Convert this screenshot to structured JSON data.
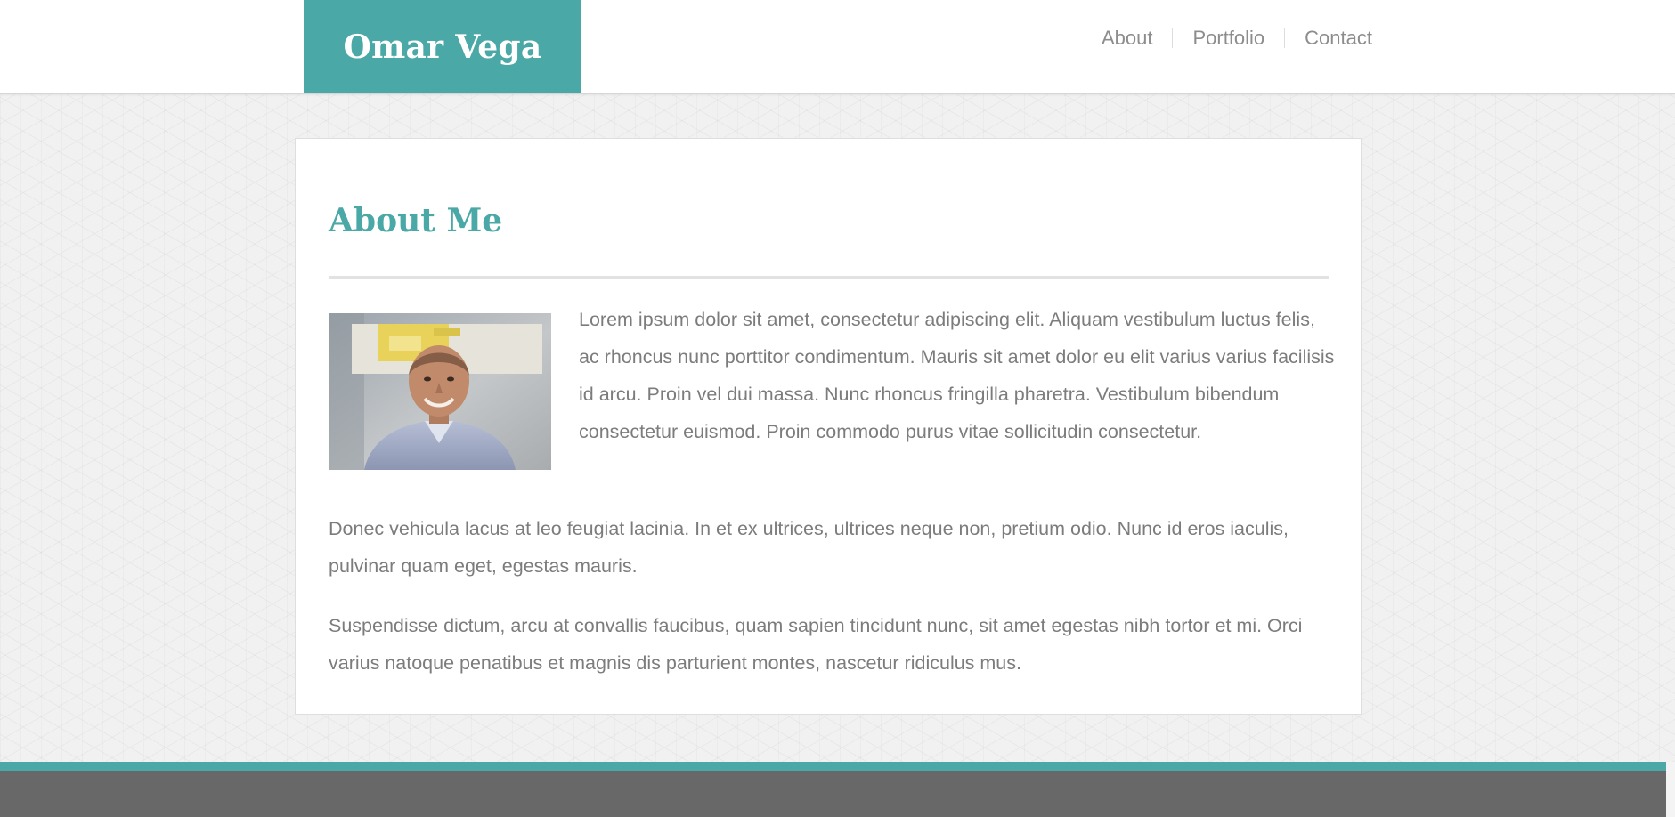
{
  "header": {
    "brand": "Omar Vega",
    "nav": [
      {
        "label": "About"
      },
      {
        "label": "Portfolio"
      },
      {
        "label": "Contact"
      }
    ]
  },
  "main": {
    "title": "About Me",
    "paragraphs": [
      "Lorem ipsum dolor sit amet, consectetur adipiscing elit. Aliquam vestibulum luctus felis, ac rhoncus nunc porttitor condimentum. Mauris sit amet dolor eu elit varius varius facilisis id arcu. Proin vel dui massa. Nunc rhoncus fringilla pharetra. Vestibulum bibendum consectetur euismod. Proin commodo purus vitae sollicitudin consectetur.",
      "Donec vehicula lacus at leo feugiat lacinia. In et ex ultrices, ultrices neque non, pretium odio. Nunc id eros iaculis, pulvinar quam eget, egestas mauris.",
      "Suspendisse dictum, arcu at convallis faucibus, quam sapien tincidunt nunc, sit amet egestas nibh tortor et mi. Orci varius natoque penatibus et magnis dis parturient montes, nascetur ridiculus mus."
    ]
  },
  "colors": {
    "accent": "#4aa8a6",
    "text": "#7c7c7c",
    "nav_text": "#8d8d8d",
    "footer": "#686868",
    "background": "#f1f1f1"
  }
}
